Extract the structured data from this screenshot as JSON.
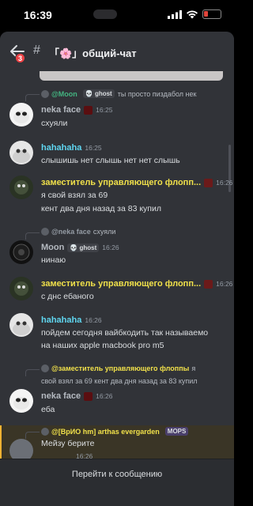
{
  "status": {
    "time": "16:39"
  },
  "header": {
    "channel_title": "「🌸」общий-чат",
    "unread_count": "3"
  },
  "messages": [
    {
      "reply": {
        "name": "@Moon",
        "tag": "💀 ghost",
        "text": "ты просто пиздабол нек"
      },
      "author": "neka face",
      "author_color": "#b5bac1",
      "time": "16:25",
      "lines": [
        "схуяли"
      ]
    },
    {
      "author": "hahahaha",
      "author_color": "#5fd6f0",
      "time": "16:25",
      "lines": [
        "слышишь нет слышь нет нет слышь"
      ]
    },
    {
      "author": "заместитель управляющего флопп...",
      "author_color": "#f0e04a",
      "time": "16:26",
      "lines": [
        "я свой взял за 69",
        "кент два дня назад за 83 купил"
      ]
    },
    {
      "reply": {
        "name": "@neka face",
        "tag": "",
        "text": "схуяли"
      },
      "author": "Moon",
      "author_color": "#b5bac1",
      "tag": "💀 ghost",
      "time": "16:26",
      "lines": [
        "нинаю"
      ]
    },
    {
      "author": "заместитель управляющего флопп...",
      "author_color": "#f0e04a",
      "time": "16:26",
      "lines": [
        "с днс ебаного"
      ]
    },
    {
      "author": "hahahaha",
      "author_color": "#5fd6f0",
      "time": "16:26",
      "lines": [
        "пойдем сегодня вайбкодить так называемо",
        "на наших apple macbook pro m5"
      ]
    },
    {
      "reply": {
        "name": "@заместитель управляющего флоппы",
        "tag": "",
        "text": "я",
        "text2": "свой взял за 69 кент два дня назад за 83 купил"
      },
      "author": "neka face",
      "author_color": "#b5bac1",
      "time": "16:26",
      "lines": [
        "еба"
      ]
    },
    {
      "reply": {
        "name": "@[ВрИО hm] arthas evergarden",
        "tag": "MOPS",
        "text": ""
      },
      "author": "",
      "author_color": "#b5bac1",
      "time": "16:26",
      "lines": [
        "Мейзу берите"
      ]
    }
  ],
  "footer": {
    "jump_label": "Перейти к сообщению"
  },
  "colors": {
    "background": "#313338",
    "mention_highlight": "#3a3526",
    "accent_yellow": "#f0b232"
  }
}
